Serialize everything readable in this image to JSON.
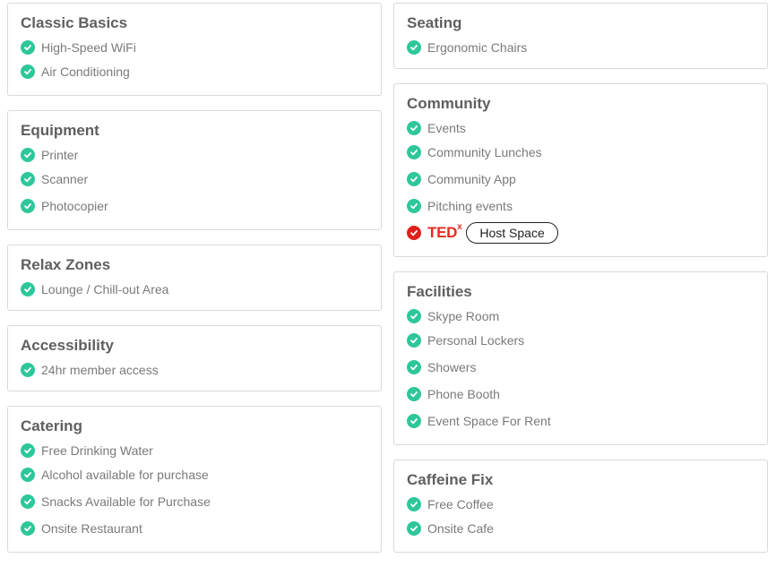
{
  "left_column": [
    {
      "title": "Classic Basics",
      "items": [
        "High-Speed WiFi",
        "Air Conditioning"
      ]
    },
    {
      "title": "Equipment",
      "items": [
        "Printer",
        "Scanner",
        "Photocopier"
      ]
    },
    {
      "title": "Relax Zones",
      "items": [
        "Lounge / Chill-out Area"
      ]
    },
    {
      "title": "Accessibility",
      "items": [
        "24hr member access"
      ]
    },
    {
      "title": "Catering",
      "items": [
        "Free Drinking Water",
        "Alcohol available for purchase",
        "Snacks Available for Purchase",
        "Onsite Restaurant"
      ]
    }
  ],
  "right_column": [
    {
      "title": "Seating",
      "items": [
        "Ergonomic Chairs"
      ]
    },
    {
      "title": "Community",
      "items": [
        "Events",
        "Community Lunches",
        "Community App",
        "Pitching events"
      ],
      "tedx": {
        "logo_text": "TED",
        "logo_sup": "x",
        "button_label": "Host Space"
      }
    },
    {
      "title": "Facilities",
      "items": [
        "Skype Room",
        "Personal Lockers",
        "Showers",
        "Phone Booth",
        "Event Space For Rent"
      ]
    },
    {
      "title": "Caffeine Fix",
      "items": [
        "Free Coffee",
        "Onsite Cafe"
      ]
    }
  ],
  "colors": {
    "check": "#2ec79a",
    "tedx_red": "#e62b1e",
    "border": "#d9d9d9"
  }
}
